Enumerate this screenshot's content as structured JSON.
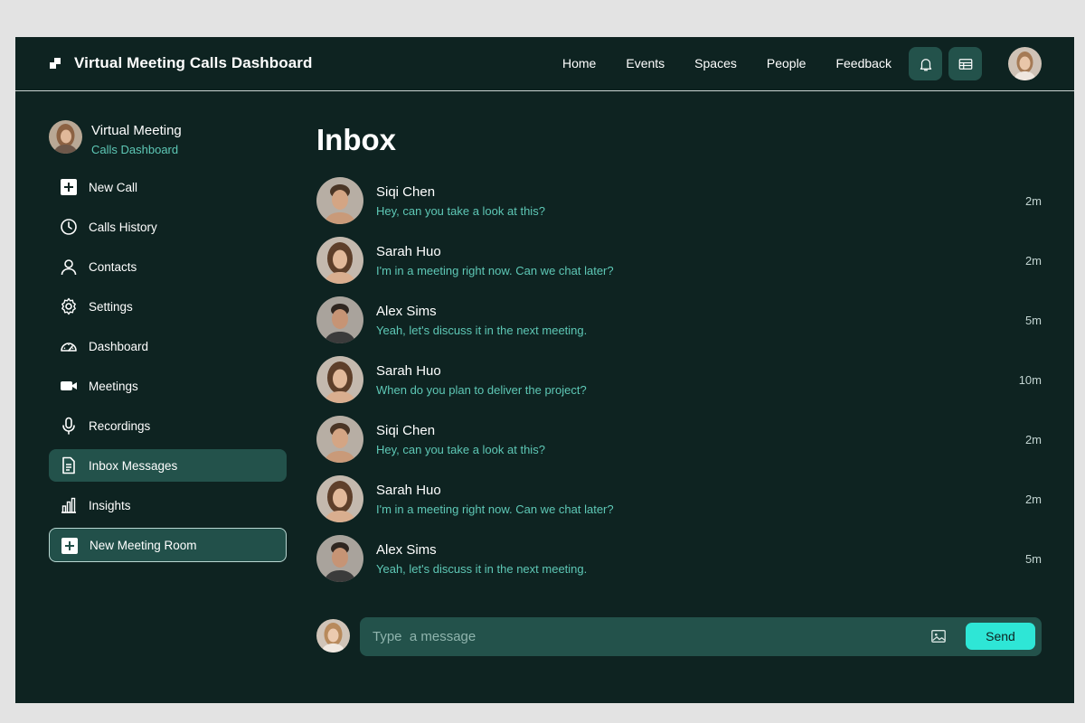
{
  "app": {
    "title": "Virtual Meeting Calls Dashboard"
  },
  "nav": {
    "items": [
      "Home",
      "Events",
      "Spaces",
      "People",
      "Feedback"
    ]
  },
  "topbar": {
    "notifications_icon": "bell-icon",
    "layout_icon": "list-layout-icon"
  },
  "sidebar": {
    "profile_name": "Virtual Meeting",
    "profile_sub": "Calls Dashboard",
    "items": [
      {
        "label": "New Call",
        "icon": "plus-square-icon",
        "active": false
      },
      {
        "label": "Calls History",
        "icon": "clock-icon",
        "active": false
      },
      {
        "label": "Contacts",
        "icon": "user-icon",
        "active": false
      },
      {
        "label": "Settings",
        "icon": "gear-icon",
        "active": false
      },
      {
        "label": "Dashboard",
        "icon": "gauge-icon",
        "active": false
      },
      {
        "label": "Meetings",
        "icon": "video-icon",
        "active": false
      },
      {
        "label": "Recordings",
        "icon": "microphone-icon",
        "active": false
      },
      {
        "label": "Inbox Messages",
        "icon": "document-icon",
        "active": true
      },
      {
        "label": "Insights",
        "icon": "bar-chart-icon",
        "active": false
      }
    ],
    "new_room_label": "New Meeting Room"
  },
  "inbox": {
    "title": "Inbox",
    "messages": [
      {
        "name": "Siqi Chen",
        "text": "Hey, can you take a look at this?",
        "time": "2m"
      },
      {
        "name": "Sarah Huo",
        "text": "I'm in a meeting right now. Can we chat later?",
        "time": "2m"
      },
      {
        "name": "Alex Sims",
        "text": "Yeah, let's discuss it in the next meeting.",
        "time": "5m"
      },
      {
        "name": "Sarah Huo",
        "text": "When do you plan to deliver the project?",
        "time": "10m"
      },
      {
        "name": "Siqi Chen",
        "text": "Hey, can you take a look at this?",
        "time": "2m"
      },
      {
        "name": "Sarah Huo",
        "text": "I'm in a meeting right now. Can we chat later?",
        "time": "2m"
      },
      {
        "name": "Alex Sims",
        "text": "Yeah, let's discuss it in the next meeting.",
        "time": "5m"
      }
    ]
  },
  "composer": {
    "placeholder": "Type  a message",
    "send_label": "Send"
  },
  "colors": {
    "background": "#0e2321",
    "accent": "#2ee6d6",
    "panel": "#23524b",
    "secondary_text": "#5ec8b6"
  }
}
